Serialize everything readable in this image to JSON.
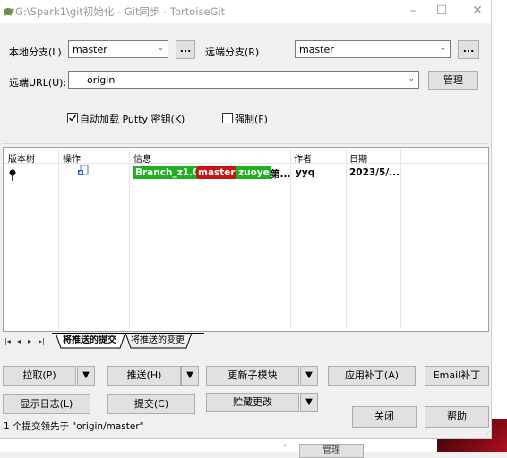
{
  "window": {
    "title": "G:\\Spark1\\git初始化 - Git同步 - TortoiseGit",
    "minimize": "–",
    "maximize": "☐",
    "close": "✕"
  },
  "branch": {
    "local_label": "本地分支(L)",
    "local_value": "master",
    "local_browse": "...",
    "remote_label": "远端分支(R)",
    "remote_value": "master",
    "remote_browse": "..."
  },
  "remote_url": {
    "label": "远端URL(U):",
    "value": "origin",
    "manage_button": "管理"
  },
  "options": {
    "autoload_putty": "自动加载 Putty 密钥(K)",
    "autoload_checked": true,
    "force": "强制(F)",
    "force_checked": false
  },
  "log_list": {
    "columns": [
      "版本树",
      "操作",
      "信息",
      "作者",
      "日期"
    ],
    "rows": [
      {
        "tags": [
          {
            "text": "Branch_z1.0",
            "color": "#20b020"
          },
          {
            "text": "master",
            "color": "#c81414"
          },
          {
            "text": "zuoye",
            "color": "#20b020"
          }
        ],
        "message": "第...",
        "author": "yyq",
        "date": "2023/5/..."
      }
    ]
  },
  "tabs": {
    "nav_first": "|◂",
    "nav_prev": "◂",
    "nav_next": "▸",
    "nav_last": "▸|",
    "active": "将推送的提交",
    "inactive": "将推送的变更"
  },
  "actions": {
    "pull": "拉取(P)",
    "push": "推送(H)",
    "update_submodule": "更新子模块",
    "apply_patch": "应用补丁(A)",
    "email_patch": "Email补丁",
    "show_log": "显示日志(L)",
    "commit": "提交(C)",
    "stash": "贮藏更改",
    "close": "关闭",
    "help": "帮助",
    "dropdown_arrow": "▼"
  },
  "status_text": "1 个提交领先于 \"origin/master\"",
  "background": {
    "behind_button": "管理",
    "behind_chevron": "˅"
  }
}
